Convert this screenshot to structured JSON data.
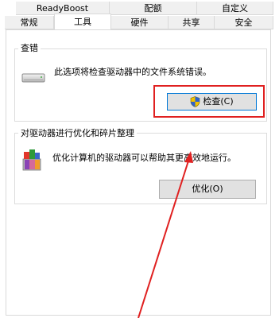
{
  "tabs_row1": [
    "ReadyBoost",
    "配额",
    "自定义"
  ],
  "tabs_row2": [
    "常规",
    "工具",
    "硬件",
    "共享",
    "安全"
  ],
  "active_tab": "工具",
  "error_check": {
    "group_title": "查错",
    "description": "此选项将检查驱动器中的文件系统错误。",
    "button_label": "检查(C)",
    "icon": "drive-icon",
    "button_icon": "shield-icon"
  },
  "optimize": {
    "group_title": "对驱动器进行优化和碎片整理",
    "description": "优化计算机的驱动器可以帮助其更高效地运行。",
    "button_label": "优化(O)",
    "icon": "defrag-icon"
  },
  "colors": {
    "highlight": "#e02020",
    "arrow": "#e02020"
  }
}
